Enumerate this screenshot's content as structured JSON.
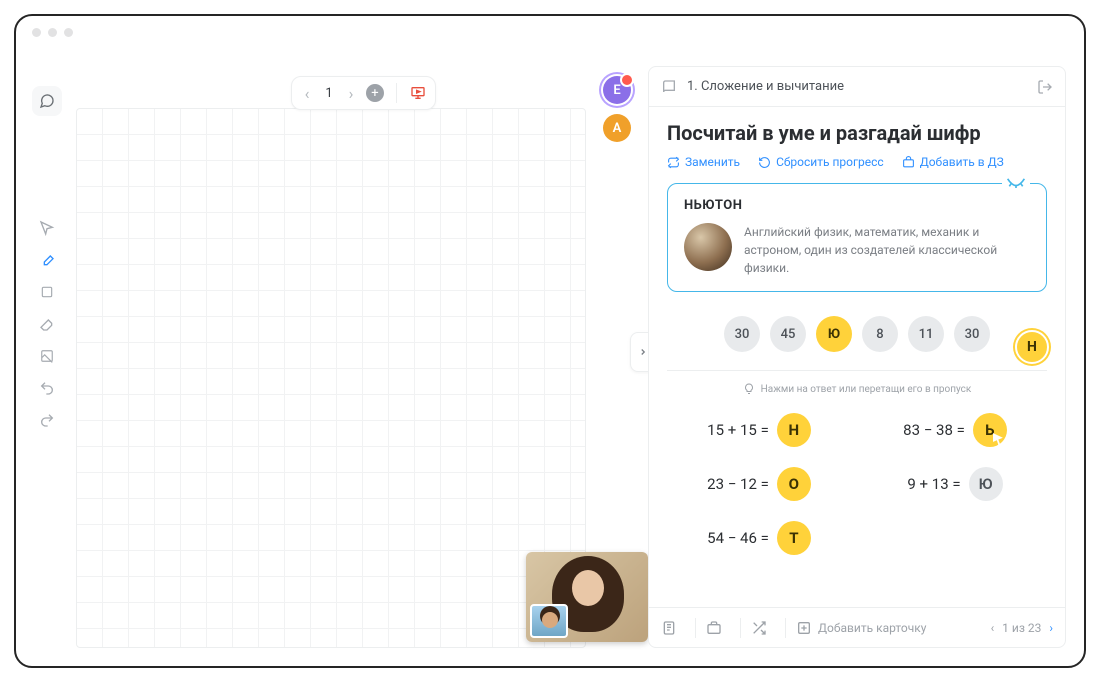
{
  "pager": {
    "page": "1"
  },
  "avatars": {
    "e": "Е",
    "a": "А"
  },
  "lesson": {
    "breadcrumb": "1. Сложение и вычитание"
  },
  "task": {
    "title": "Посчитай в уме и разгадай шифр",
    "actions": {
      "replace": "Заменить",
      "reset": "Сбросить прогресс",
      "add_hw": "Добавить в ДЗ"
    }
  },
  "card": {
    "name": "НЬЮТОН",
    "desc": "Английский физик, математик, механик и астроном, один из создателей классической физики."
  },
  "chips": [
    "30",
    "45",
    "Ю",
    "8",
    "11",
    "30"
  ],
  "float_chip": "Н",
  "hint": "Нажми на ответ или перетащи его в пропуск",
  "equations": [
    {
      "expr": "15 + 15 =",
      "ans": "Н",
      "style": "gold"
    },
    {
      "expr": "83 − 38 =",
      "ans": "Ь",
      "style": "gold cursor"
    },
    {
      "expr": "23 − 12  =",
      "ans": "О",
      "style": "gold"
    },
    {
      "expr": "9 + 13 =",
      "ans": "Ю",
      "style": "grey"
    },
    {
      "expr": "54 − 46 =",
      "ans": "Т",
      "style": "gold"
    }
  ],
  "footer": {
    "add_card": "Добавить карточку",
    "pager": "1 из 23"
  }
}
